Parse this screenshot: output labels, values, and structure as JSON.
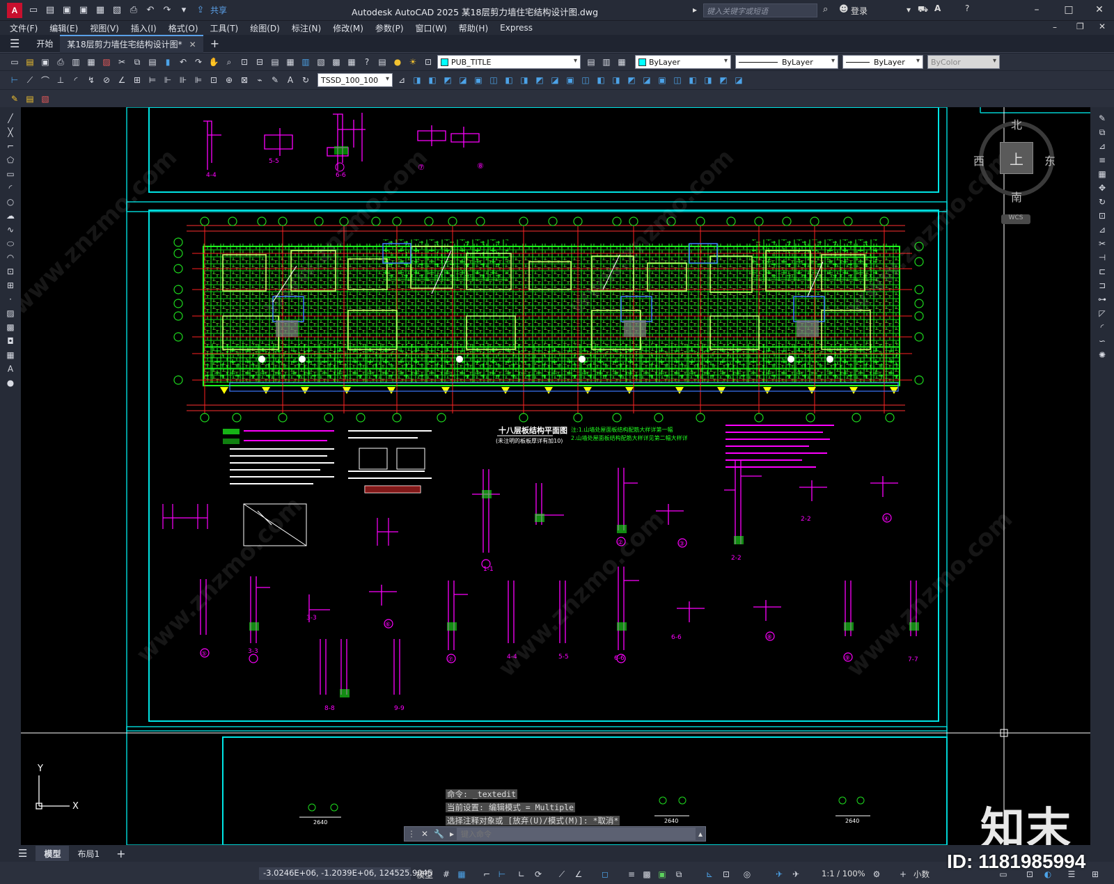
{
  "app": {
    "title": "Autodesk AutoCAD 2025    某18层剪力墙住宅结构设计图.dwg",
    "share": "共享",
    "search_placeholder": "键入关键字或短语",
    "login": "登录"
  },
  "menu": [
    "文件(F)",
    "编辑(E)",
    "视图(V)",
    "插入(I)",
    "格式(O)",
    "工具(T)",
    "绘图(D)",
    "标注(N)",
    "修改(M)",
    "参数(P)",
    "窗口(W)",
    "帮助(H)",
    "Express"
  ],
  "file_tabs": [
    {
      "label": "开始"
    },
    {
      "label": "某18层剪力墙住宅结构设计图*",
      "active": true
    }
  ],
  "toolbar": {
    "layer": "PUB_TITLE",
    "color": "ByLayer",
    "linetype": "ByLayer",
    "lineweight": "ByLayer",
    "plotstyle": "ByColor",
    "textstyle": "TSSD_100_100"
  },
  "viewcube": {
    "north": "北",
    "south": "南",
    "east": "东",
    "west": "西",
    "face": "上",
    "wcs": "WCS"
  },
  "drawing": {
    "top_labels": [
      "4-4",
      "5-5",
      "6-6",
      "⑦",
      "⑧"
    ],
    "plan_title": "十八层板结构平面图",
    "plan_subtitle": "(未注明的板板厚详有加10)",
    "section_labels": [
      "1-1",
      "②",
      "③",
      "2-2",
      "④",
      "2-2",
      "3-3",
      "⑤",
      "3-3",
      "⑥",
      "⑦",
      "4-4",
      "5-5",
      "6-6",
      "6-6",
      "⑧",
      "⑨",
      "7-7",
      "8-8",
      "9-9"
    ],
    "note_green_1": "注:1.山墙处屋面板结构配筋大样详第一幅",
    "note_green_2": "2.山墙处屋面板结构配筋大样详见第二幅大样详",
    "bottom_marks": [
      "2640",
      "2640",
      "2640"
    ]
  },
  "command": {
    "history": [
      "命令: _textedit",
      "当前设置: 编辑模式 = Multiple",
      "选择注释对象或 [放弃(U)/模式(M)]: *取消*"
    ],
    "placeholder": "键入命令"
  },
  "layout_tabs": [
    {
      "label": "模型",
      "active": true
    },
    {
      "label": "布局1"
    }
  ],
  "status": {
    "coords": "-3.0246E+06, -1.2039E+06, 124525.9045",
    "model": "模型",
    "scale": "1:1 / 100%",
    "units": "小数"
  },
  "watermark": {
    "brand": "知末",
    "id": "ID: 1181985994",
    "diag": "www.znzmo.com"
  },
  "colors": {
    "canvas": "#000000",
    "frame": "#00e5e5",
    "wall": "#00ff00",
    "grid": "#ff2020",
    "detail": "#ff00ff",
    "axis": "#e6e6e6"
  }
}
